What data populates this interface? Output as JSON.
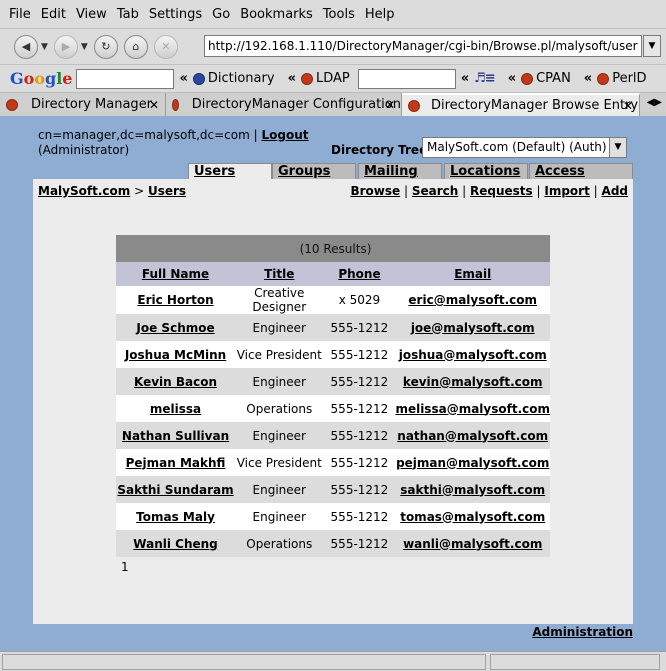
{
  "menus": [
    "File",
    "Edit",
    "View",
    "Tab",
    "Settings",
    "Go",
    "Bookmarks",
    "Tools",
    "Help"
  ],
  "url": "http://192.168.1.110/DirectoryManager/cgi-bin/Browse.pl/malysoft/user",
  "bookmarks": {
    "search_logo": "Google",
    "arrow": "«",
    "items": [
      "Dictionary",
      "LDAP",
      "CPAN",
      "PerlD"
    ]
  },
  "tabs": [
    "Directory Manager",
    "DirectoryManager Configuration",
    "DirectoryManager Browse Entry"
  ],
  "page": {
    "login": "cn=manager,dc=malysoft,dc=com",
    "separator": "|",
    "logout": "Logout",
    "role": "(Administrator)",
    "tree_label": "Directory Tree:",
    "tree_value": "MalySoft.com (Default) (Auth)",
    "dir_tabs": [
      "Users",
      "Groups",
      "Mailing Lists",
      "Locations",
      "Access Groups"
    ],
    "breadcrumb_root": "MalySoft.com",
    "breadcrumb_sep": ">",
    "breadcrumb_current": "Users",
    "actions": [
      "Browse",
      "Search",
      "Requests",
      "Import",
      "Add"
    ],
    "results_count": "(10 Results)",
    "columns": [
      "Full Name",
      "Title",
      "Phone",
      "Email"
    ],
    "rows": [
      {
        "name": "Eric Horton",
        "title": "Creative Designer",
        "phone": "x 5029",
        "email": "eric@malysoft.com"
      },
      {
        "name": "Joe Schmoe",
        "title": "Engineer",
        "phone": "555-1212",
        "email": "joe@malysoft.com"
      },
      {
        "name": "Joshua McMinn",
        "title": "Vice President",
        "phone": "555-1212",
        "email": "joshua@malysoft.com"
      },
      {
        "name": "Kevin Bacon",
        "title": "Engineer",
        "phone": "555-1212",
        "email": "kevin@malysoft.com"
      },
      {
        "name": "melissa",
        "title": "Operations",
        "phone": "555-1212",
        "email": "melissa@malysoft.com"
      },
      {
        "name": "Nathan Sullivan",
        "title": "Engineer",
        "phone": "555-1212",
        "email": "nathan@malysoft.com"
      },
      {
        "name": "Pejman Makhfi",
        "title": "Vice President",
        "phone": "555-1212",
        "email": "pejman@malysoft.com"
      },
      {
        "name": "Sakthi Sundaram",
        "title": "Engineer",
        "phone": "555-1212",
        "email": "sakthi@malysoft.com"
      },
      {
        "name": "Tomas Maly",
        "title": "Engineer",
        "phone": "555-1212",
        "email": "tomas@malysoft.com"
      },
      {
        "name": "Wanli Cheng",
        "title": "Operations",
        "phone": "555-1212",
        "email": "wanli@malysoft.com"
      }
    ],
    "page_number": "1",
    "admin_link": "Administration"
  },
  "colors": {
    "page_bg": "#8fadd2",
    "panel_bg": "#ececec",
    "header_row": "#c3c3d7",
    "results_bar": "#8a8a8a"
  }
}
